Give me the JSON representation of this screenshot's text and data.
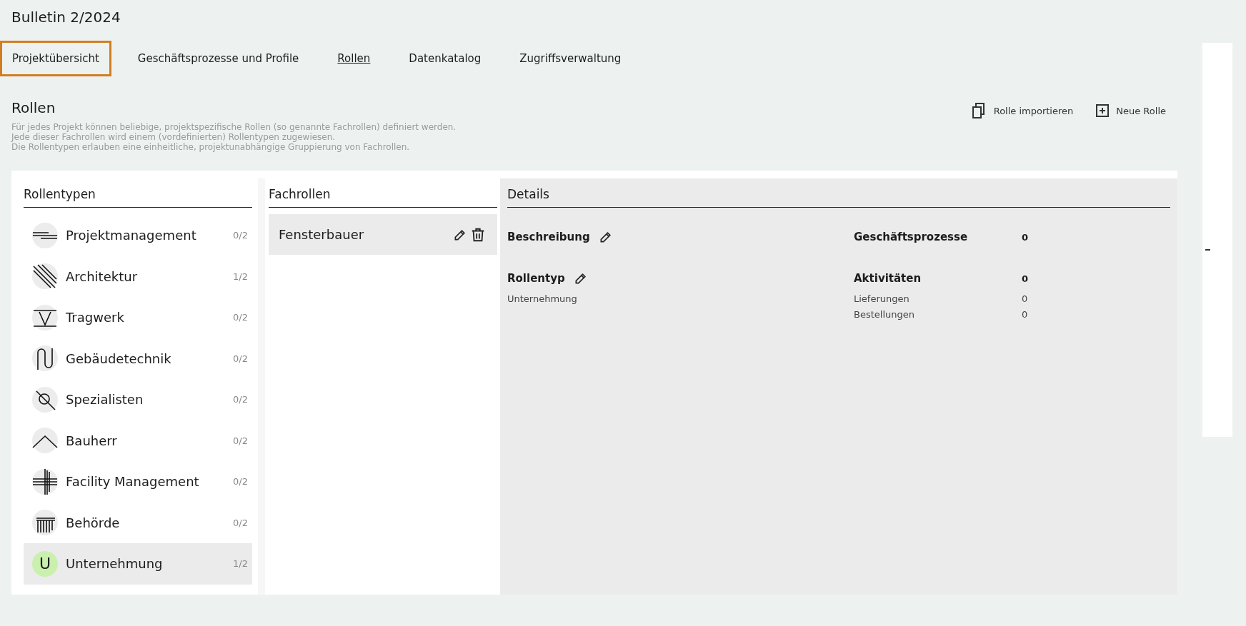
{
  "title": "Bulletin 2/2024",
  "tabs": [
    {
      "label": "Projektübersicht",
      "selected": false,
      "focused": true
    },
    {
      "label": "Geschäftsprozesse und Profile",
      "selected": false,
      "focused": false
    },
    {
      "label": "Rollen",
      "selected": true,
      "focused": false
    },
    {
      "label": "Datenkatalog",
      "selected": false,
      "focused": false
    },
    {
      "label": "Zugriffsverwaltung",
      "selected": false,
      "focused": false
    }
  ],
  "heading": "Rollen",
  "description": [
    "Für jedes Projekt können beliebige, projektspezifische Rollen (so genannte Fachrollen) definiert werden.",
    "Jede dieser Fachrollen wird einem (vordefinierten) Rollentypen zugewiesen.",
    "Die Rollentypen erlauben eine einheitliche, projektunabhängige Gruppierung von Fachrollen."
  ],
  "actions": [
    {
      "kind": "import",
      "label": "Rolle importieren"
    },
    {
      "kind": "add",
      "label": "Neue Rolle"
    }
  ],
  "role_types": {
    "header": "Rollentypen",
    "items": [
      {
        "kind": "lines",
        "label": "Projektmanagement",
        "count": "0/2",
        "selected": false
      },
      {
        "kind": "diagonals",
        "label": "Architektur",
        "count": "1/2",
        "selected": false
      },
      {
        "kind": "triangle",
        "label": "Tragwerk",
        "count": "0/2",
        "selected": false
      },
      {
        "kind": "pipe",
        "label": "Gebäudetechnik",
        "count": "0/2",
        "selected": false
      },
      {
        "kind": "lens",
        "label": "Spezialisten",
        "count": "0/2",
        "selected": false
      },
      {
        "kind": "roof",
        "label": "Bauherr",
        "count": "0/2",
        "selected": false
      },
      {
        "kind": "grid",
        "label": "Facility Management",
        "count": "0/2",
        "selected": false
      },
      {
        "kind": "columns",
        "label": "Behörde",
        "count": "0/2",
        "selected": false
      },
      {
        "kind": "letter",
        "letter": "U",
        "label": "Unternehmung",
        "count": "1/2",
        "selected": true
      }
    ]
  },
  "specialist_roles": {
    "header": "Fachrollen",
    "items": [
      {
        "label": "Fensterbauer",
        "selected": true
      }
    ]
  },
  "details": {
    "header": "Details",
    "description": {
      "label": "Beschreibung"
    },
    "role_type": {
      "label": "Rollentyp",
      "value": "Unternehmung"
    },
    "business_processes": {
      "label": "Geschäftsprozesse",
      "value": "0"
    },
    "activities": {
      "label": "Aktivitäten",
      "value": "0",
      "items": [
        {
          "label": "Lieferungen",
          "value": "0"
        },
        {
          "label": "Bestellungen",
          "value": "0"
        }
      ]
    }
  }
}
